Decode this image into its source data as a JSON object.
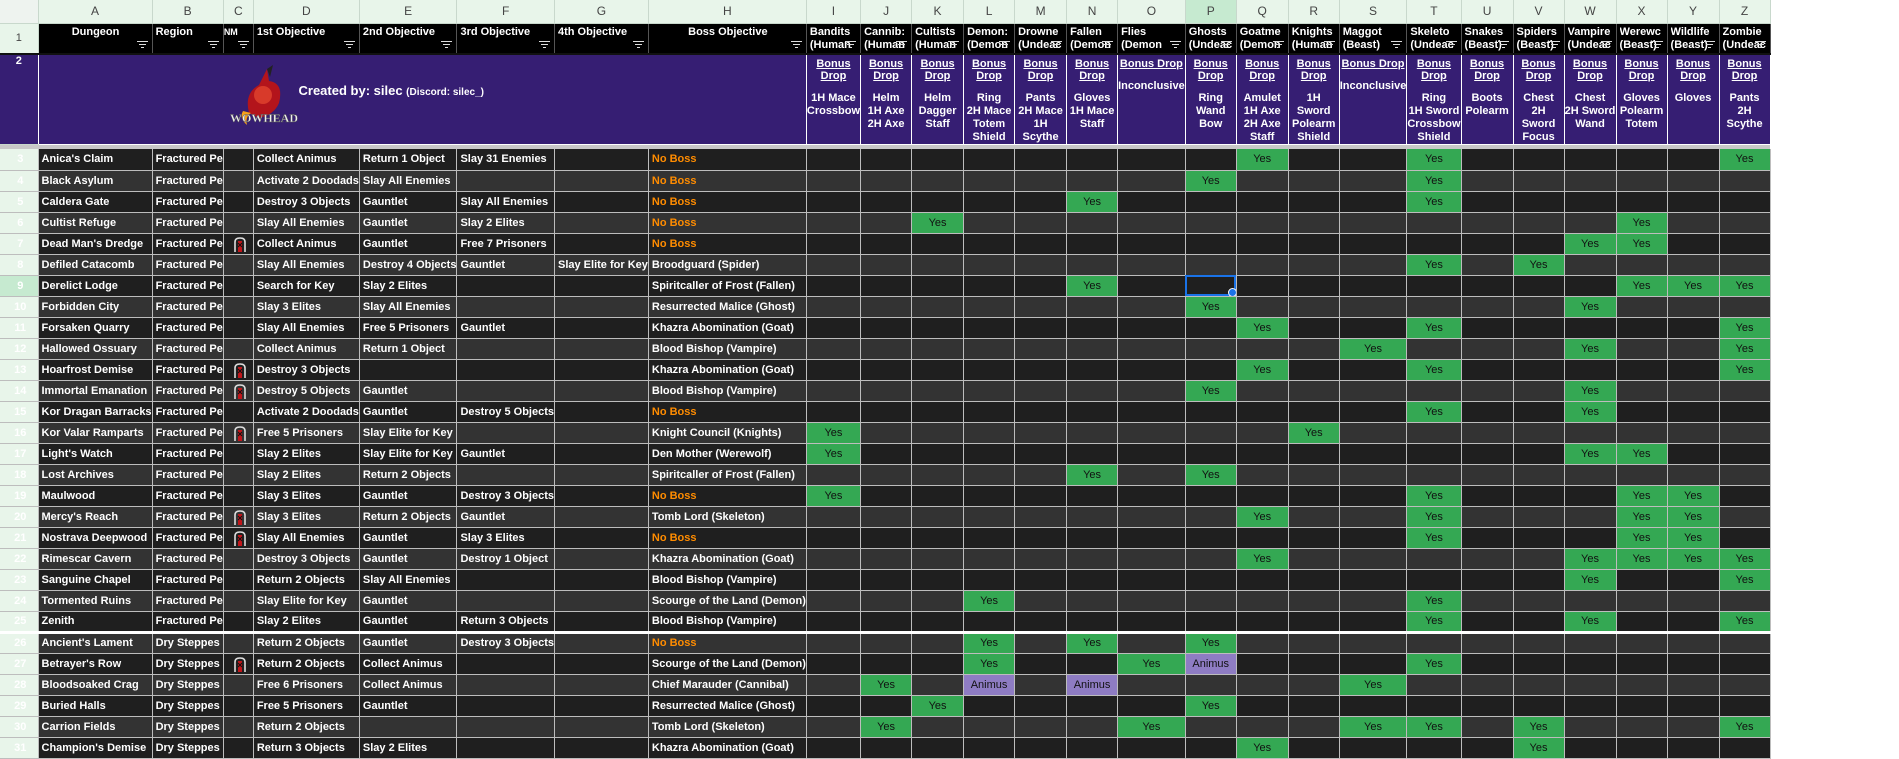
{
  "column_letters": [
    "A",
    "B",
    "C",
    "D",
    "E",
    "F",
    "G",
    "H",
    "I",
    "J",
    "K",
    "L",
    "M",
    "N",
    "O",
    "P",
    "Q",
    "R",
    "S",
    "T",
    "U",
    "V",
    "W",
    "X",
    "Y",
    "Z"
  ],
  "selected_column": "P",
  "selected_cell": "P9",
  "headers": {
    "dungeon": "Dungeon",
    "region": "Region",
    "nm": "NM",
    "obj1": "1st Objective",
    "obj2": "2nd Objective",
    "obj3": "3rd Objective",
    "obj4": "4th Objective",
    "boss": "Boss Objective",
    "families": [
      {
        "name": "Bandits (Human)",
        "shown": "Bandits\n(Human",
        "drops": [
          "1H Mace",
          "Crossbow"
        ]
      },
      {
        "name": "Cannibals (Human)",
        "shown": "Cannib:\n(Human",
        "drops": [
          "Helm",
          "1H Axe",
          "2H Axe"
        ]
      },
      {
        "name": "Cultists (Human)",
        "shown": "Cultists\n(Human",
        "drops": [
          "Helm",
          "Dagger",
          "Staff"
        ]
      },
      {
        "name": "Demons (Demon)",
        "shown": "Demon:\n(Demon",
        "drops": [
          "Ring",
          "2H Mace",
          "Totem",
          "Shield"
        ]
      },
      {
        "name": "Drowned (Undead)",
        "shown": "Drowne\n(Undeac",
        "drops": [
          "Pants",
          "2H Mace",
          "1H Scythe"
        ]
      },
      {
        "name": "Fallen (Demon)",
        "shown": "Fallen\n(Demon",
        "drops": [
          "Gloves",
          "1H Mace",
          "Staff"
        ]
      },
      {
        "name": "Flies (Demon)",
        "shown": "Flies\n(Demon",
        "drops": [
          "Inconclusive"
        ]
      },
      {
        "name": "Ghosts (Undead)",
        "shown": "Ghosts\n(Undeac",
        "drops": [
          "Ring",
          "Wand",
          "Bow"
        ]
      },
      {
        "name": "Goatmen (Demon)",
        "shown": "Goatme\n(Demon",
        "drops": [
          "Amulet",
          "1H Axe",
          "2H Axe",
          "Staff"
        ]
      },
      {
        "name": "Knights (Human)",
        "shown": "Knights\n(Human",
        "drops": [
          "1H Sword",
          "Polearm",
          "Shield"
        ]
      },
      {
        "name": "Maggot (Beast)",
        "shown": "Maggot\n(Beast)",
        "drops": [
          "Inconclusive"
        ]
      },
      {
        "name": "Skeletons (Undead)",
        "shown": "Skeleto\n(Undeac",
        "drops": [
          "Ring",
          "1H Sword",
          "Crossbow",
          "Shield"
        ]
      },
      {
        "name": "Snakes (Beast)",
        "shown": "Snakes\n(Beast)",
        "drops": [
          "Boots",
          "Polearm"
        ]
      },
      {
        "name": "Spiders (Beast)",
        "shown": "Spiders\n(Beast)",
        "drops": [
          "Chest",
          "2H Sword",
          "Focus"
        ]
      },
      {
        "name": "Vampires (Undead)",
        "shown": "Vampire\n(Undeac",
        "drops": [
          "Chest",
          "2H Sword",
          "Wand"
        ]
      },
      {
        "name": "Werewolves (Beast)",
        "shown": "Werewc\n(Beast)",
        "drops": [
          "Gloves",
          "Polearm",
          "Totem"
        ]
      },
      {
        "name": "Wildlife (Beast)",
        "shown": "Wildlife\n(Beast)",
        "drops": [
          "Gloves"
        ]
      },
      {
        "name": "Zombies (Undead)",
        "shown": "Zombie\n(Undeac",
        "drops": [
          "Pants",
          "2H Scythe"
        ]
      }
    ],
    "bonus_drop_label": "Bonus Drop"
  },
  "banner": {
    "logo_text": "WOWHEAD",
    "credit": "Created by: silec",
    "discord": "(Discord: silec_)"
  },
  "colors": {
    "yes": "#34a853",
    "animus": "#8e7cc3",
    "no_boss": "#ff8c00",
    "banner_bg": "#361e73",
    "row_dark": "#1f1f1f",
    "row_light": "#333333"
  },
  "rows": [
    {
      "n": 3,
      "dungeon": "Anica's Claim",
      "region": "Fractured Pe",
      "nm": false,
      "o1": "Collect Animus",
      "o2": "Return 1 Object",
      "o3": "Slay 31 Enemies",
      "o4": "",
      "boss": "No Boss",
      "marks": {
        "Q": "Yes",
        "T": "Yes",
        "Z": "Yes"
      }
    },
    {
      "n": 4,
      "dungeon": "Black Asylum",
      "region": "Fractured Pe",
      "nm": false,
      "o1": "Activate 2 Doodads",
      "o2": "Slay All Enemies",
      "o3": "",
      "o4": "",
      "boss": "No Boss",
      "marks": {
        "P": "Yes",
        "T": "Yes"
      }
    },
    {
      "n": 5,
      "dungeon": "Caldera Gate",
      "region": "Fractured Pe",
      "nm": false,
      "o1": "Destroy 3 Objects",
      "o2": "Gauntlet",
      "o3": "Slay All Enemies",
      "o4": "",
      "boss": "No Boss",
      "marks": {
        "N": "Yes",
        "T": "Yes"
      }
    },
    {
      "n": 6,
      "dungeon": "Cultist Refuge",
      "region": "Fractured Pe",
      "nm": false,
      "o1": "Slay All Enemies",
      "o2": "Gauntlet",
      "o3": "Slay 2 Elites",
      "o4": "",
      "boss": "No Boss",
      "marks": {
        "K": "Yes",
        "X": "Yes"
      }
    },
    {
      "n": 7,
      "dungeon": "Dead Man's Dredge",
      "region": "Fractured Pe",
      "nm": true,
      "o1": "Collect Animus",
      "o2": "Gauntlet",
      "o3": "Free 7 Prisoners",
      "o4": "",
      "boss": "No Boss",
      "marks": {
        "W": "Yes",
        "X": "Yes"
      }
    },
    {
      "n": 8,
      "dungeon": "Defiled Catacomb",
      "region": "Fractured Pe",
      "nm": false,
      "o1": "Slay All Enemies",
      "o2": "Destroy 4 Objects",
      "o3": "Gauntlet",
      "o4": "Slay Elite for Key",
      "boss": "Broodguard (Spider)",
      "marks": {
        "T": "Yes",
        "V": "Yes"
      }
    },
    {
      "n": 9,
      "dungeon": "Derelict Lodge",
      "region": "Fractured Pe",
      "nm": false,
      "o1": "Search for Key",
      "o2": "Slay 2 Elites",
      "o3": "",
      "o4": "",
      "boss": "Spiritcaller of Frost (Fallen)",
      "marks": {
        "N": "Yes",
        "X": "Yes",
        "Y": "Yes",
        "Z": "Yes"
      }
    },
    {
      "n": 10,
      "dungeon": "Forbidden City",
      "region": "Fractured Pe",
      "nm": false,
      "o1": "Slay 3 Elites",
      "o2": "Slay All Enemies",
      "o3": "",
      "o4": "",
      "boss": "Resurrected Malice (Ghost)",
      "marks": {
        "P": "Yes",
        "W": "Yes"
      }
    },
    {
      "n": 11,
      "dungeon": "Forsaken Quarry",
      "region": "Fractured Pe",
      "nm": false,
      "o1": "Slay All Enemies",
      "o2": "Free 5 Prisoners",
      "o3": "Gauntlet",
      "o4": "",
      "boss": "Khazra Abomination (Goat)",
      "marks": {
        "Q": "Yes",
        "T": "Yes",
        "Z": "Yes"
      }
    },
    {
      "n": 12,
      "dungeon": "Hallowed Ossuary",
      "region": "Fractured Pe",
      "nm": false,
      "o1": "Collect Animus",
      "o2": "Return 1 Object",
      "o3": "",
      "o4": "",
      "boss": "Blood Bishop (Vampire)",
      "marks": {
        "S": "Yes",
        "W": "Yes",
        "Z": "Yes"
      }
    },
    {
      "n": 13,
      "dungeon": "Hoarfrost Demise",
      "region": "Fractured Pe",
      "nm": true,
      "o1": "Destroy 3 Objects",
      "o2": "",
      "o3": "",
      "o4": "",
      "boss": "Khazra Abomination (Goat)",
      "marks": {
        "Q": "Yes",
        "T": "Yes",
        "Z": "Yes"
      }
    },
    {
      "n": 14,
      "dungeon": "Immortal Emanation",
      "region": "Fractured Pe",
      "nm": true,
      "o1": "Destroy 5 Objects",
      "o2": "Gauntlet",
      "o3": "",
      "o4": "",
      "boss": "Blood Bishop (Vampire)",
      "marks": {
        "P": "Yes",
        "W": "Yes"
      }
    },
    {
      "n": 15,
      "dungeon": "Kor Dragan Barracks",
      "region": "Fractured Pe",
      "nm": false,
      "o1": "Activate 2 Doodads",
      "o2": "Gauntlet",
      "o3": "Destroy 5 Objects",
      "o4": "",
      "boss": "No Boss",
      "marks": {
        "T": "Yes",
        "W": "Yes"
      }
    },
    {
      "n": 16,
      "dungeon": "Kor Valar Ramparts",
      "region": "Fractured Pe",
      "nm": true,
      "o1": "Free 5 Prisoners",
      "o2": "Slay Elite for Key",
      "o3": "",
      "o4": "",
      "boss": "Knight Council (Knights)",
      "marks": {
        "I": "Yes",
        "R": "Yes"
      }
    },
    {
      "n": 17,
      "dungeon": "Light's Watch",
      "region": "Fractured Pe",
      "nm": false,
      "o1": "Slay 2 Elites",
      "o2": "Slay Elite for Key",
      "o3": "Gauntlet",
      "o4": "",
      "boss": "Den Mother (Werewolf)",
      "marks": {
        "I": "Yes",
        "W": "Yes",
        "X": "Yes"
      }
    },
    {
      "n": 18,
      "dungeon": "Lost Archives",
      "region": "Fractured Pe",
      "nm": false,
      "o1": "Slay 2 Elites",
      "o2": "Return 2 Objects",
      "o3": "",
      "o4": "",
      "boss": "Spiritcaller of Frost (Fallen)",
      "marks": {
        "N": "Yes",
        "P": "Yes"
      }
    },
    {
      "n": 19,
      "dungeon": "Maulwood",
      "region": "Fractured Pe",
      "nm": false,
      "o1": "Slay 3 Elites",
      "o2": "Gauntlet",
      "o3": "Destroy 3 Objects",
      "o4": "",
      "boss": "No Boss",
      "marks": {
        "I": "Yes",
        "T": "Yes",
        "X": "Yes",
        "Y": "Yes"
      }
    },
    {
      "n": 20,
      "dungeon": "Mercy's Reach",
      "region": "Fractured Pe",
      "nm": true,
      "o1": "Slay 3 Elites",
      "o2": "Return 2 Objects",
      "o3": "Gauntlet",
      "o4": "",
      "boss": "Tomb Lord (Skeleton)",
      "marks": {
        "Q": "Yes",
        "T": "Yes",
        "X": "Yes",
        "Y": "Yes"
      }
    },
    {
      "n": 21,
      "dungeon": "Nostrava Deepwood",
      "region": "Fractured Pe",
      "nm": true,
      "o1": "Slay All Enemies",
      "o2": "Gauntlet",
      "o3": "Slay 3 Elites",
      "o4": "",
      "boss": "No Boss",
      "marks": {
        "T": "Yes",
        "X": "Yes",
        "Y": "Yes"
      }
    },
    {
      "n": 22,
      "dungeon": "Rimescar Cavern",
      "region": "Fractured Pe",
      "nm": false,
      "o1": "Destroy 3 Objects",
      "o2": "Gauntlet",
      "o3": "Destroy 1 Object",
      "o4": "",
      "boss": "Khazra Abomination (Goat)",
      "marks": {
        "Q": "Yes",
        "W": "Yes",
        "X": "Yes",
        "Y": "Yes",
        "Z": "Yes"
      }
    },
    {
      "n": 23,
      "dungeon": "Sanguine Chapel",
      "region": "Fractured Pe",
      "nm": false,
      "o1": "Return 2 Objects",
      "o2": "Slay All Enemies",
      "o3": "",
      "o4": "",
      "boss": "Blood Bishop (Vampire)",
      "marks": {
        "W": "Yes",
        "Z": "Yes"
      }
    },
    {
      "n": 24,
      "dungeon": "Tormented Ruins",
      "region": "Fractured Pe",
      "nm": false,
      "o1": "Slay Elite for Key",
      "o2": "Gauntlet",
      "o3": "",
      "o4": "",
      "boss": "Scourge of the Land (Demon)",
      "marks": {
        "L": "Yes",
        "T": "Yes"
      }
    },
    {
      "n": 25,
      "dungeon": "Zenith",
      "region": "Fractured Pe",
      "nm": false,
      "o1": "Slay 2 Elites",
      "o2": "Gauntlet",
      "o3": "Return 3 Objects",
      "o4": "",
      "boss": "Blood Bishop (Vampire)",
      "marks": {
        "T": "Yes",
        "W": "Yes",
        "Z": "Yes"
      }
    },
    {
      "n": 26,
      "dungeon": "Ancient's Lament",
      "region": "Dry Steppes",
      "nm": false,
      "o1": "Return 2 Objects",
      "o2": "Gauntlet",
      "o3": "Destroy 3 Objects",
      "o4": "",
      "boss": "No Boss",
      "marks": {
        "L": "Yes",
        "N": "Yes",
        "P": "Yes"
      }
    },
    {
      "n": 27,
      "dungeon": "Betrayer's Row",
      "region": "Dry Steppes",
      "nm": true,
      "o1": "Return 2 Objects",
      "o2": "Collect Animus",
      "o3": "",
      "o4": "",
      "boss": "Scourge of the Land (Demon)",
      "marks": {
        "L": "Yes",
        "O": "Yes",
        "P": "Animus",
        "T": "Yes"
      }
    },
    {
      "n": 28,
      "dungeon": "Bloodsoaked Crag",
      "region": "Dry Steppes",
      "nm": false,
      "o1": "Free 6 Prisoners",
      "o2": "Collect Animus",
      "o3": "",
      "o4": "",
      "boss": "Chief Marauder (Cannibal)",
      "marks": {
        "J": "Yes",
        "L": "Animus",
        "N": "Animus",
        "S": "Yes"
      }
    },
    {
      "n": 29,
      "dungeon": "Buried Halls",
      "region": "Dry Steppes",
      "nm": false,
      "o1": "Free 5 Prisoners",
      "o2": "Gauntlet",
      "o3": "",
      "o4": "",
      "boss": "Resurrected Malice (Ghost)",
      "marks": {
        "K": "Yes",
        "P": "Yes"
      }
    },
    {
      "n": 30,
      "dungeon": "Carrion Fields",
      "region": "Dry Steppes",
      "nm": false,
      "o1": "Return 2 Objects",
      "o2": "",
      "o3": "",
      "o4": "",
      "boss": "Tomb Lord (Skeleton)",
      "marks": {
        "J": "Yes",
        "O": "Yes",
        "S": "Yes",
        "T": "Yes",
        "V": "Yes",
        "Z": "Yes"
      }
    },
    {
      "n": 31,
      "dungeon": "Champion's Demise",
      "region": "Dry Steppes",
      "nm": false,
      "o1": "Return 3 Objects",
      "o2": "Slay 2 Elites",
      "o3": "",
      "o4": "",
      "boss": "Khazra Abomination (Goat)",
      "marks": {
        "Q": "Yes",
        "V": "Yes"
      }
    }
  ]
}
